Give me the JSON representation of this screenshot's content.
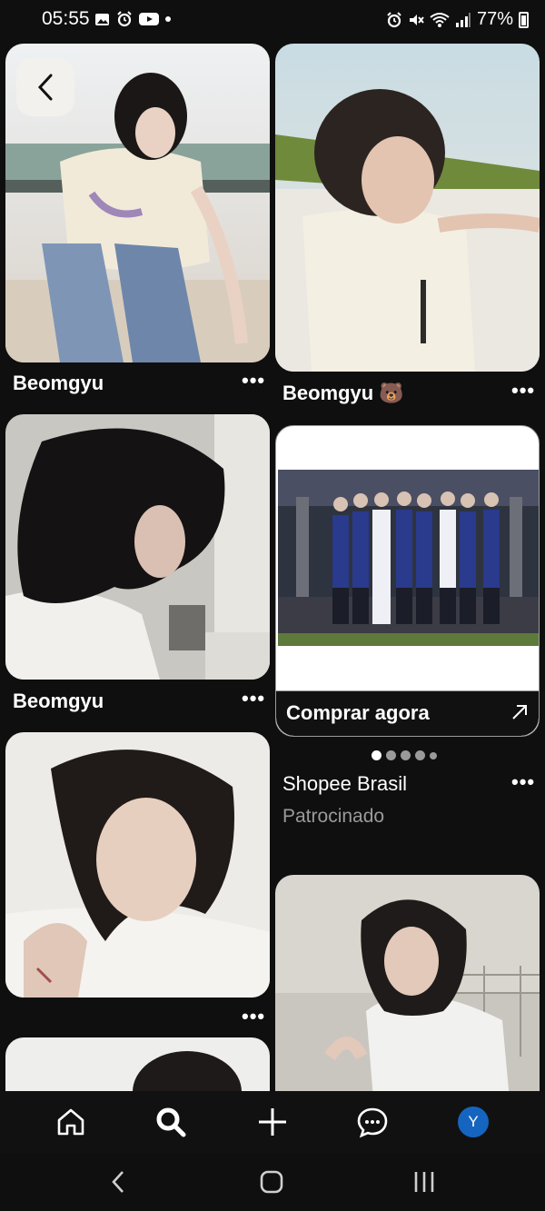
{
  "status_bar": {
    "time": "05:55",
    "battery": "77%",
    "left_icons": [
      "image-icon",
      "alarm-icon",
      "youtube-icon",
      "dot-icon"
    ],
    "right_icons": [
      "alarm-icon",
      "mute-icon",
      "wifi-icon",
      "signal-icon",
      "battery-icon"
    ]
  },
  "feed": {
    "pins": [
      {
        "title": "Beomgyu"
      },
      {
        "title": "Beomgyu 🐻"
      },
      {
        "title": "Beomgyu"
      },
      {
        "title": ""
      },
      {
        "title": ""
      },
      {
        "title": ""
      }
    ],
    "more_label": "•••",
    "ad": {
      "cta_label": "Comprar agora",
      "advertiser": "Shopee Brasil",
      "sponsored_label": "Patrocinado",
      "carousel_count": 5,
      "carousel_active": 0
    }
  },
  "nav": {
    "items": [
      "home-icon",
      "search-icon",
      "create-icon",
      "messages-icon",
      "profile-avatar"
    ],
    "active": "search",
    "avatar_letter": "Y",
    "avatar_color": "#1565c0"
  },
  "system_nav": [
    "back-icon",
    "home-icon",
    "recents-icon"
  ]
}
